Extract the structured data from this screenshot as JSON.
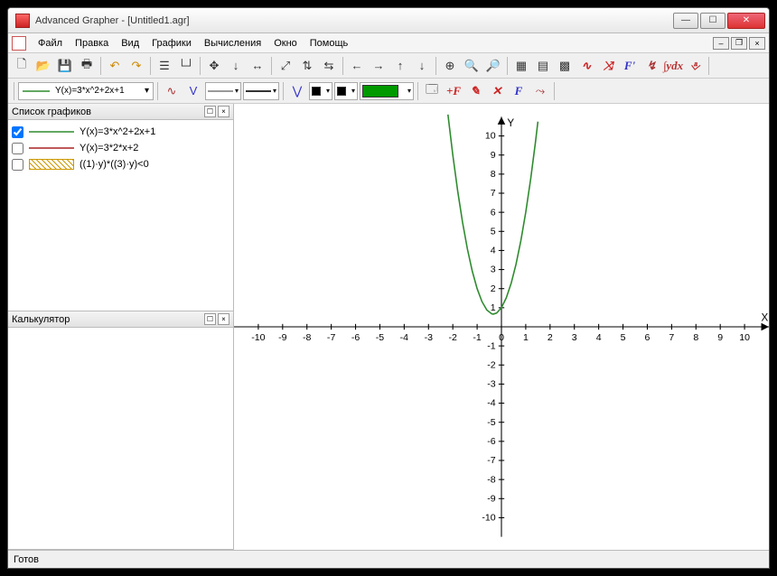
{
  "window": {
    "title": "Advanced Grapher - [Untitled1.agr]"
  },
  "menu": {
    "file": "Файл",
    "edit": "Правка",
    "view": "Вид",
    "graphs": "Графики",
    "calc": "Вычисления",
    "window": "Окно",
    "help": "Помощь"
  },
  "toolbar2": {
    "current_graph_label": "Y(x)=3*x^2+2x+1"
  },
  "panels": {
    "graphlist_title": "Список графиков",
    "calculator_title": "Калькулятор",
    "items": [
      {
        "checked": true,
        "color": "#2e8b2e",
        "style": "solid",
        "label": "Y(x)=3*x^2+2x+1"
      },
      {
        "checked": false,
        "color": "#aa2222",
        "style": "solid",
        "label": "Y(x)=3*2*x+2"
      },
      {
        "checked": false,
        "color": "#cc9900",
        "style": "hatch",
        "label": "((1)·y)*((3)·y)<0"
      }
    ]
  },
  "status": {
    "text": "Готов"
  },
  "chart_data": {
    "type": "line",
    "title": "",
    "xlabel": "X",
    "ylabel": "Y",
    "xlim": [
      -11,
      11
    ],
    "ylim": [
      -11,
      11
    ],
    "xticks": [
      -10,
      -9,
      -8,
      -7,
      -6,
      -5,
      -4,
      -3,
      -2,
      -1,
      0,
      1,
      2,
      3,
      4,
      5,
      6,
      7,
      8,
      9,
      10
    ],
    "yticks": [
      -10,
      -9,
      -8,
      -7,
      -6,
      -5,
      -4,
      -3,
      -2,
      -1,
      1,
      2,
      3,
      4,
      5,
      6,
      7,
      8,
      9,
      10
    ],
    "series": [
      {
        "name": "Y(x)=3*x^2+2x+1",
        "color": "#2e8b2e",
        "x": [
          -2.2,
          -2.0,
          -1.8,
          -1.6,
          -1.4,
          -1.2,
          -1.0,
          -0.8,
          -0.6,
          -0.4,
          -0.333,
          -0.2,
          0.0,
          0.2,
          0.4,
          0.6,
          0.8,
          1.0,
          1.2,
          1.4,
          1.5
        ],
        "y": [
          11.12,
          9.0,
          7.12,
          5.48,
          4.08,
          2.92,
          2.0,
          1.32,
          0.88,
          0.68,
          0.667,
          0.72,
          1.0,
          1.52,
          2.28,
          3.28,
          4.52,
          6.0,
          7.72,
          9.68,
          10.75
        ]
      }
    ]
  }
}
